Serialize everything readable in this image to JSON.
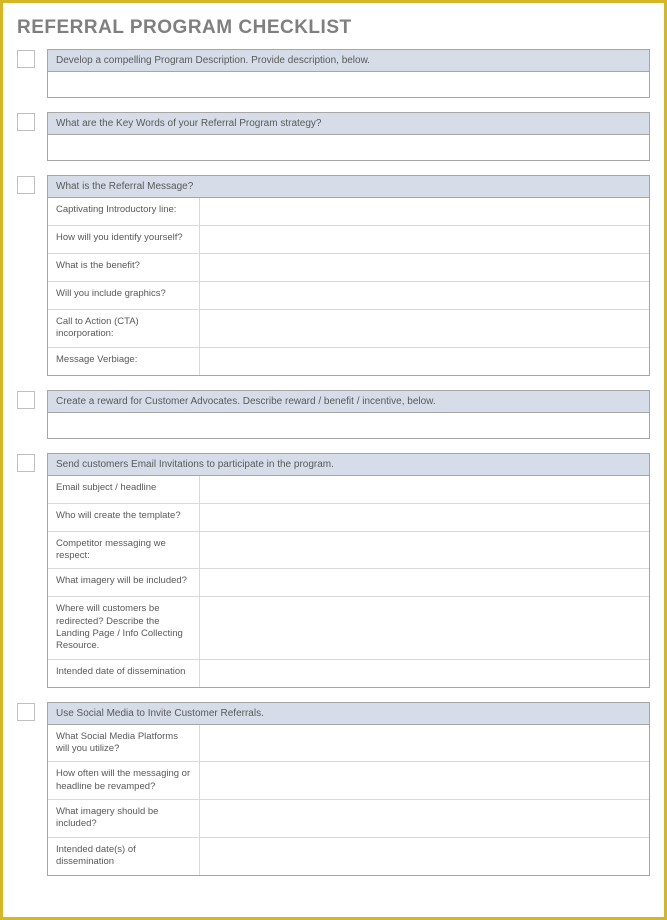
{
  "title": "REFERRAL PROGRAM CHECKLIST",
  "sections": [
    {
      "header": "Develop a compelling Program Description.  Provide description, below.",
      "blank": true
    },
    {
      "header": "What are the Key Words of your Referral Program strategy?",
      "blank": true
    },
    {
      "header": "What is the Referral Message?",
      "rows": [
        "Captivating Introductory line:",
        "How will you identify yourself?",
        "What is the benefit?",
        "Will you include graphics?",
        "Call to Action (CTA) incorporation:",
        "Message Verbiage:"
      ]
    },
    {
      "header": "Create a reward for Customer Advocates.  Describe reward / benefit / incentive, below.",
      "blank": true
    },
    {
      "header": "Send customers Email Invitations to participate in the program.",
      "rows": [
        "Email subject / headline",
        "Who will create the template?",
        "Competitor messaging we respect:",
        "What imagery will be included?",
        "Where will customers be redirected? Describe the Landing Page / Info Collecting Resource.",
        "Intended date of dissemination"
      ]
    },
    {
      "header": "Use Social Media to Invite Customer Referrals.",
      "rows": [
        "What Social Media Platforms will you utilize?",
        "How often will the messaging or headline be revamped?",
        "What imagery should be included?",
        "Intended date(s) of dissemination"
      ]
    }
  ]
}
